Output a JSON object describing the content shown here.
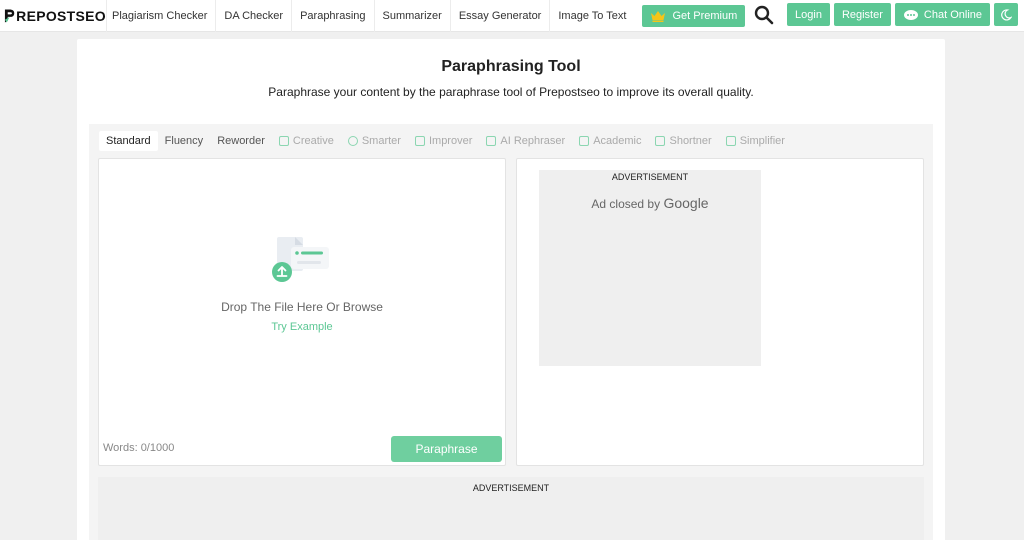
{
  "logo": {
    "text": "REPOSTSEO"
  },
  "nav": {
    "items": [
      {
        "label": "Plagiarism Checker"
      },
      {
        "label": "DA Checker"
      },
      {
        "label": "Paraphrasing"
      },
      {
        "label": "Summarizer"
      },
      {
        "label": "Essay Generator"
      },
      {
        "label": "Image To Text"
      }
    ],
    "premium_label": "Get Premium",
    "login_label": "Login",
    "register_label": "Register",
    "chat_label": "Chat Online"
  },
  "page": {
    "title": "Paraphrasing Tool",
    "subtitle": "Paraphrase your content by the paraphrase tool of Prepostseo to improve its overall quality."
  },
  "tabs": [
    {
      "label": "Standard",
      "active": true,
      "locked": false
    },
    {
      "label": "Fluency",
      "active": false,
      "locked": false
    },
    {
      "label": "Reworder",
      "active": false,
      "locked": false
    },
    {
      "label": "Creative",
      "active": false,
      "locked": true
    },
    {
      "label": "Smarter",
      "active": false,
      "locked": true
    },
    {
      "label": "Improver",
      "active": false,
      "locked": true
    },
    {
      "label": "AI Rephraser",
      "active": false,
      "locked": true
    },
    {
      "label": "Academic",
      "active": false,
      "locked": true
    },
    {
      "label": "Shortner",
      "active": false,
      "locked": true
    },
    {
      "label": "Simplifier",
      "active": false,
      "locked": true
    }
  ],
  "editor": {
    "drop_text": "Drop The File Here Or Browse",
    "try_example": "Try Example",
    "word_count": "Words: 0/1000",
    "button_label": "Paraphrase"
  },
  "ads": {
    "label": "ADVERTISEMENT",
    "closed_text": "Ad closed by",
    "closed_brand": "Google",
    "bottom_label": "ADVERTISEMENT"
  },
  "colors": {
    "accent": "#5cc794",
    "button": "#6fcf9f"
  }
}
